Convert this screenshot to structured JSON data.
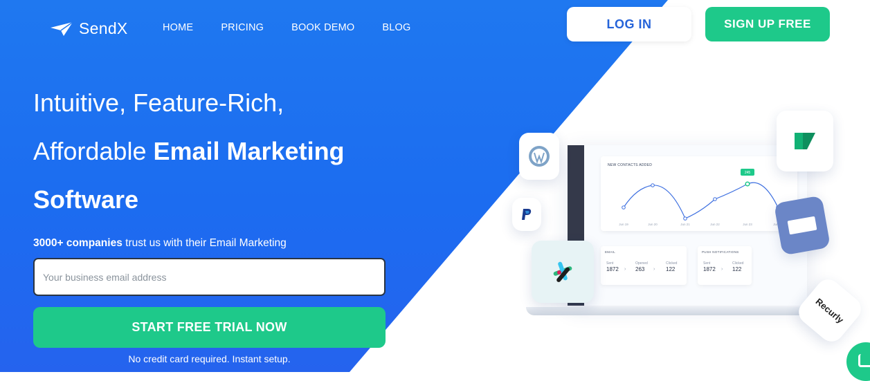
{
  "nav": {
    "logo_text": "SendX",
    "links": [
      "HOME",
      "PRICING",
      "BOOK DEMO",
      "BLOG"
    ],
    "login_label": "LOG IN",
    "signup_label": "SIGN UP FREE"
  },
  "hero": {
    "line1": "Intuitive, Feature-Rich,",
    "line2_regular": "Affordable ",
    "line2_bold": "Email Marketing",
    "line3": "Software",
    "trust_bold": "3000+ companies",
    "trust_rest": " trust us with their Email Marketing",
    "email_placeholder": "Your business email address",
    "cta_label": "START FREE TRIAL NOW",
    "note": "No credit card required. Instant setup."
  },
  "illustration": {
    "chart_title": "NEW CONTACTS ADDED",
    "x_labels": [
      "Jun 19",
      "Jun 20",
      "Jun 21",
      "Jun 22",
      "Jun 23",
      "Jun 24"
    ],
    "tooltip": "245",
    "email_card": {
      "label": "EMAIL",
      "cols": [
        {
          "k": "Sent",
          "v": "1872"
        },
        {
          "k": "Opened",
          "v": "263"
        },
        {
          "k": "Clicked",
          "v": "122"
        }
      ]
    },
    "push_card": {
      "label": "PUSH NOTIFICATIONS",
      "cols": [
        {
          "k": "Sent",
          "v": "1872"
        },
        {
          "k": "Clicked",
          "v": "122"
        }
      ]
    },
    "recurly_text": "Recurly"
  },
  "colors": {
    "brand_blue": "#1f78f0",
    "accent_green": "#1ec98a",
    "login_text": "#2563d9"
  },
  "icons": [
    "paper-plane-icon",
    "wordpress-icon",
    "paypal-icon",
    "slack-icon",
    "brand-green-icon",
    "card-icon",
    "chat-icon"
  ]
}
